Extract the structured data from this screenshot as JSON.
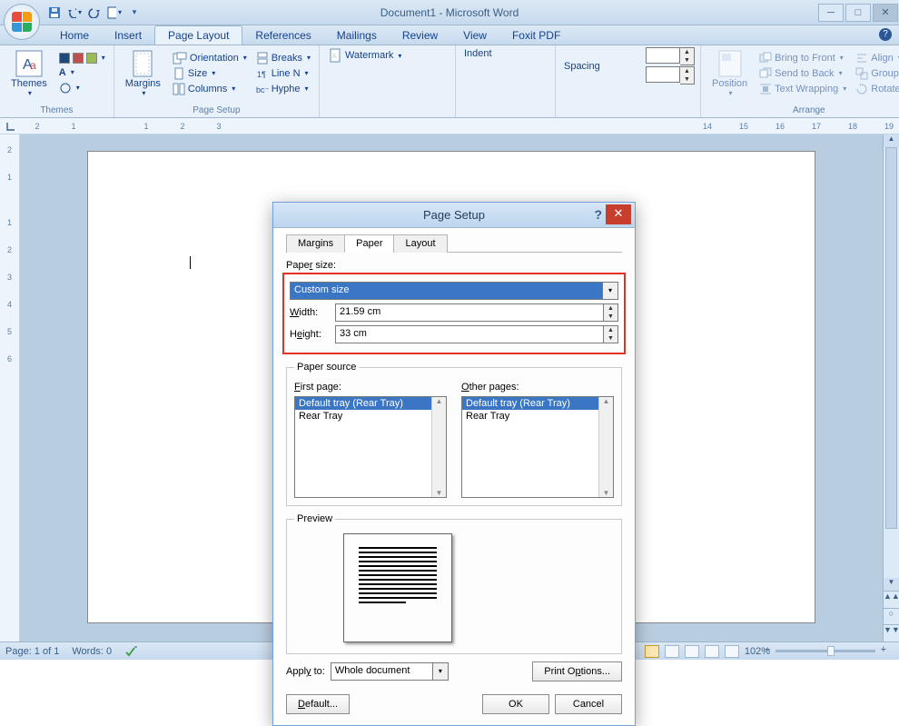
{
  "title": "Document1 - Microsoft Word",
  "qat_icons": [
    "save-icon",
    "undo-icon",
    "redo-icon",
    "new-doc-icon"
  ],
  "tabs": [
    "Home",
    "Insert",
    "Page Layout",
    "References",
    "Mailings",
    "Review",
    "View",
    "Foxit PDF"
  ],
  "active_tab": "Page Layout",
  "ribbon": {
    "themes": {
      "label": "Themes",
      "big": "Themes"
    },
    "page_setup": {
      "label": "Page Setup",
      "margins": "Margins",
      "orientation": "Orientation",
      "size": "Size",
      "columns": "Columns",
      "breaks": "Breaks",
      "line_n": "Line N",
      "hyphe": "Hyphe"
    },
    "page_bg": {
      "watermark": "Watermark"
    },
    "paragraph": {
      "indent": "Indent",
      "spacing": "Spacing"
    },
    "arrange": {
      "label": "Arrange",
      "position": "Position",
      "bring_front": "Bring to Front",
      "send_back": "Send to Back",
      "text_wrap": "Text Wrapping",
      "align": "Align",
      "group": "Group",
      "rotate": "Rotate"
    }
  },
  "ruler_h": [
    "2",
    "1",
    "",
    "1",
    "2",
    "3"
  ],
  "ruler_h_right": [
    "14",
    "15",
    "16",
    "17",
    "18",
    "19"
  ],
  "ruler_v": [
    "2",
    "1",
    "",
    "1",
    "2",
    "3",
    "4",
    "5",
    "6"
  ],
  "status": {
    "page": "Page: 1 of 1",
    "words": "Words: 0",
    "zoom": "102%"
  },
  "dialog": {
    "title": "Page Setup",
    "tabs": [
      "Margins",
      "Paper",
      "Layout"
    ],
    "active_tab": "Paper",
    "paper_size_label": "Paper size:",
    "paper_size_value": "Custom size",
    "width_label": "Width:",
    "width_value": "21.59 cm",
    "height_label": "Height:",
    "height_value": "33 cm",
    "paper_source": "Paper source",
    "first_page": "First page:",
    "other_pages": "Other pages:",
    "tray_items": [
      "Default tray (Rear Tray)",
      "Rear Tray"
    ],
    "preview": "Preview",
    "apply_to": "Apply to:",
    "apply_value": "Whole document",
    "print_options": "Print Options...",
    "default": "Default...",
    "ok": "OK",
    "cancel": "Cancel"
  }
}
